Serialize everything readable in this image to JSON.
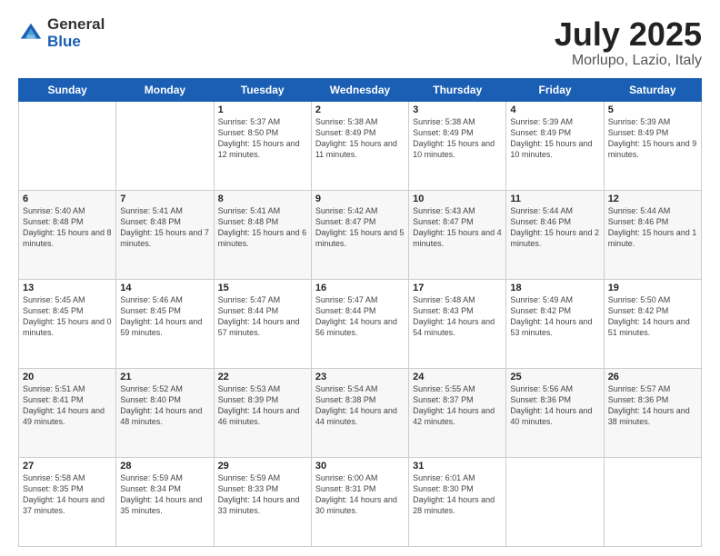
{
  "logo": {
    "general": "General",
    "blue": "Blue"
  },
  "title": "July 2025",
  "subtitle": "Morlupo, Lazio, Italy",
  "days_header": [
    "Sunday",
    "Monday",
    "Tuesday",
    "Wednesday",
    "Thursday",
    "Friday",
    "Saturday"
  ],
  "weeks": [
    [
      {
        "num": "",
        "info": ""
      },
      {
        "num": "",
        "info": ""
      },
      {
        "num": "1",
        "info": "Sunrise: 5:37 AM\nSunset: 8:50 PM\nDaylight: 15 hours and 12 minutes."
      },
      {
        "num": "2",
        "info": "Sunrise: 5:38 AM\nSunset: 8:49 PM\nDaylight: 15 hours and 11 minutes."
      },
      {
        "num": "3",
        "info": "Sunrise: 5:38 AM\nSunset: 8:49 PM\nDaylight: 15 hours and 10 minutes."
      },
      {
        "num": "4",
        "info": "Sunrise: 5:39 AM\nSunset: 8:49 PM\nDaylight: 15 hours and 10 minutes."
      },
      {
        "num": "5",
        "info": "Sunrise: 5:39 AM\nSunset: 8:49 PM\nDaylight: 15 hours and 9 minutes."
      }
    ],
    [
      {
        "num": "6",
        "info": "Sunrise: 5:40 AM\nSunset: 8:48 PM\nDaylight: 15 hours and 8 minutes."
      },
      {
        "num": "7",
        "info": "Sunrise: 5:41 AM\nSunset: 8:48 PM\nDaylight: 15 hours and 7 minutes."
      },
      {
        "num": "8",
        "info": "Sunrise: 5:41 AM\nSunset: 8:48 PM\nDaylight: 15 hours and 6 minutes."
      },
      {
        "num": "9",
        "info": "Sunrise: 5:42 AM\nSunset: 8:47 PM\nDaylight: 15 hours and 5 minutes."
      },
      {
        "num": "10",
        "info": "Sunrise: 5:43 AM\nSunset: 8:47 PM\nDaylight: 15 hours and 4 minutes."
      },
      {
        "num": "11",
        "info": "Sunrise: 5:44 AM\nSunset: 8:46 PM\nDaylight: 15 hours and 2 minutes."
      },
      {
        "num": "12",
        "info": "Sunrise: 5:44 AM\nSunset: 8:46 PM\nDaylight: 15 hours and 1 minute."
      }
    ],
    [
      {
        "num": "13",
        "info": "Sunrise: 5:45 AM\nSunset: 8:45 PM\nDaylight: 15 hours and 0 minutes."
      },
      {
        "num": "14",
        "info": "Sunrise: 5:46 AM\nSunset: 8:45 PM\nDaylight: 14 hours and 59 minutes."
      },
      {
        "num": "15",
        "info": "Sunrise: 5:47 AM\nSunset: 8:44 PM\nDaylight: 14 hours and 57 minutes."
      },
      {
        "num": "16",
        "info": "Sunrise: 5:47 AM\nSunset: 8:44 PM\nDaylight: 14 hours and 56 minutes."
      },
      {
        "num": "17",
        "info": "Sunrise: 5:48 AM\nSunset: 8:43 PM\nDaylight: 14 hours and 54 minutes."
      },
      {
        "num": "18",
        "info": "Sunrise: 5:49 AM\nSunset: 8:42 PM\nDaylight: 14 hours and 53 minutes."
      },
      {
        "num": "19",
        "info": "Sunrise: 5:50 AM\nSunset: 8:42 PM\nDaylight: 14 hours and 51 minutes."
      }
    ],
    [
      {
        "num": "20",
        "info": "Sunrise: 5:51 AM\nSunset: 8:41 PM\nDaylight: 14 hours and 49 minutes."
      },
      {
        "num": "21",
        "info": "Sunrise: 5:52 AM\nSunset: 8:40 PM\nDaylight: 14 hours and 48 minutes."
      },
      {
        "num": "22",
        "info": "Sunrise: 5:53 AM\nSunset: 8:39 PM\nDaylight: 14 hours and 46 minutes."
      },
      {
        "num": "23",
        "info": "Sunrise: 5:54 AM\nSunset: 8:38 PM\nDaylight: 14 hours and 44 minutes."
      },
      {
        "num": "24",
        "info": "Sunrise: 5:55 AM\nSunset: 8:37 PM\nDaylight: 14 hours and 42 minutes."
      },
      {
        "num": "25",
        "info": "Sunrise: 5:56 AM\nSunset: 8:36 PM\nDaylight: 14 hours and 40 minutes."
      },
      {
        "num": "26",
        "info": "Sunrise: 5:57 AM\nSunset: 8:36 PM\nDaylight: 14 hours and 38 minutes."
      }
    ],
    [
      {
        "num": "27",
        "info": "Sunrise: 5:58 AM\nSunset: 8:35 PM\nDaylight: 14 hours and 37 minutes."
      },
      {
        "num": "28",
        "info": "Sunrise: 5:59 AM\nSunset: 8:34 PM\nDaylight: 14 hours and 35 minutes."
      },
      {
        "num": "29",
        "info": "Sunrise: 5:59 AM\nSunset: 8:33 PM\nDaylight: 14 hours and 33 minutes."
      },
      {
        "num": "30",
        "info": "Sunrise: 6:00 AM\nSunset: 8:31 PM\nDaylight: 14 hours and 30 minutes."
      },
      {
        "num": "31",
        "info": "Sunrise: 6:01 AM\nSunset: 8:30 PM\nDaylight: 14 hours and 28 minutes."
      },
      {
        "num": "",
        "info": ""
      },
      {
        "num": "",
        "info": ""
      }
    ]
  ]
}
